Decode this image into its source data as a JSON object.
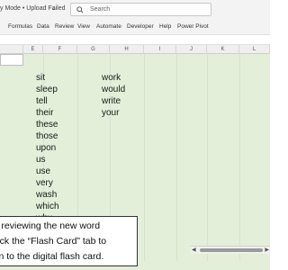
{
  "titlebar": {
    "doc_title": "y Mode • Upload Failed",
    "caret": "⌄",
    "search_placeholder": "Search"
  },
  "ribbon": {
    "tabs": [
      "Formulas",
      "Data",
      "Review",
      "View",
      "Automate",
      "Developer",
      "Help",
      "Power Pivot"
    ]
  },
  "columns": [
    "E",
    "F",
    "G",
    "H",
    "I",
    "J",
    "K",
    "L"
  ],
  "sheet": {
    "column_f_words": [
      "sit",
      "sleep",
      "tell",
      "their",
      "these",
      "those",
      "upon",
      "us",
      "use",
      "very",
      "wash",
      "which",
      "why"
    ],
    "column_h_words": [
      "work",
      "would",
      "write",
      "your"
    ]
  },
  "callout": {
    "lines": [
      "r reviewing the new word",
      "lick the “Flash Card” tab to",
      "rn to the digital flash card."
    ]
  },
  "colors": {
    "grid_fill": "#e3efd9",
    "chrome": "#f3f3f3"
  }
}
